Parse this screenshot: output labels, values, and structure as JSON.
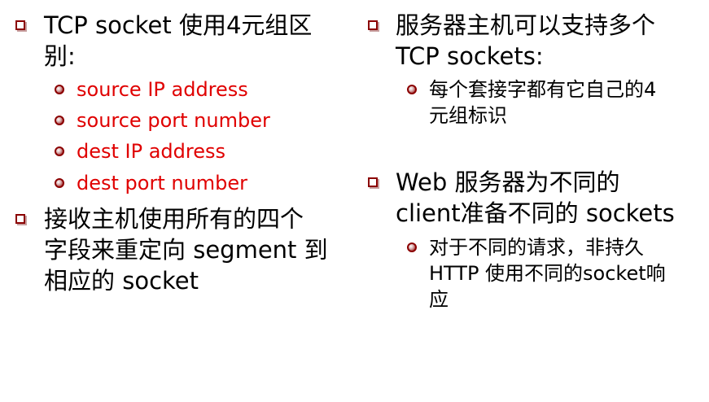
{
  "left": {
    "b1": {
      "text": "TCP socket 使用4元组区\n别:"
    },
    "b1_sub": [
      {
        "text": "source IP address"
      },
      {
        "text": "source port number"
      },
      {
        "text": "dest IP address"
      },
      {
        "text": "dest port number"
      }
    ],
    "b2": {
      "text": "接收主机使用所有的四个\n字段来重定向 segment 到\n相应的 socket"
    }
  },
  "right": {
    "b1": {
      "text": "服务器主机可以支持多个\nTCP sockets:"
    },
    "b1_sub": [
      {
        "text": "每个套接字都有它自己的4\n元组标识"
      }
    ],
    "b2": {
      "text": "Web 服务器为不同的\nclient准备不同的 sockets"
    },
    "b2_sub": [
      {
        "text": "对于不同的请求，非持久\nHTTP 使用不同的socket响\n应"
      }
    ]
  },
  "colors": {
    "bullet": "#8b0000",
    "highlight_text": "#e00000"
  }
}
